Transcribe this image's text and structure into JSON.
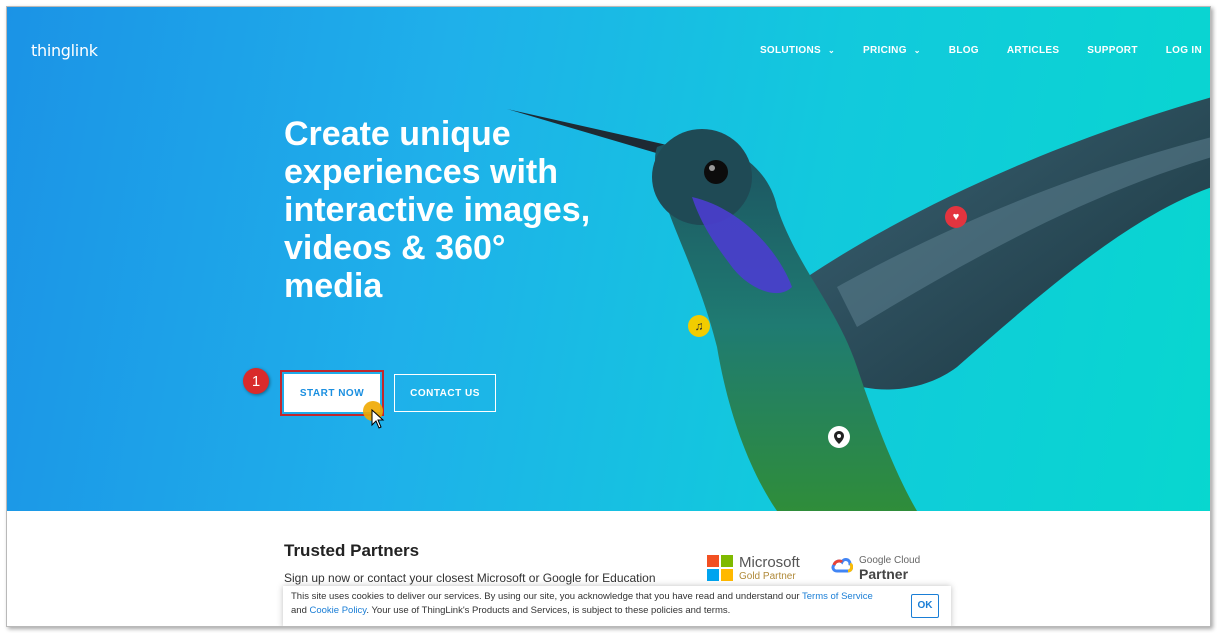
{
  "header": {
    "logo": "thinglink",
    "nav": [
      {
        "label": "SOLUTIONS",
        "has_dropdown": true
      },
      {
        "label": "PRICING",
        "has_dropdown": true
      },
      {
        "label": "BLOG",
        "has_dropdown": false
      },
      {
        "label": "ARTICLES",
        "has_dropdown": false
      },
      {
        "label": "SUPPORT",
        "has_dropdown": false
      },
      {
        "label": "LOG IN",
        "has_dropdown": false
      }
    ]
  },
  "hero": {
    "headline_lines": [
      "Create unique",
      "experiences with",
      "interactive images,",
      "videos & 360°",
      "media"
    ],
    "start_button": "START NOW",
    "contact_button": "CONTACT US",
    "step_badge": "1"
  },
  "partners": {
    "title": "Trusted Partners",
    "text": "Sign up now or contact your closest Microsoft or Google for Education",
    "microsoft": {
      "name": "Microsoft",
      "tier": "Gold Partner"
    },
    "google": {
      "name": "Google Cloud",
      "tier": "Partner"
    }
  },
  "cookie": {
    "text_before_terms": "This site uses cookies to deliver our services. By using our site, you acknowledge that you have read and understand our ",
    "terms_link": "Terms of Service",
    "and": " and ",
    "cookie_link": "Cookie Policy",
    "text_after": ". Your use of ThingLink's Products and Services, is subject to these policies and terms.",
    "ok_label": "OK"
  },
  "colors": {
    "hero_start": "#1b93e6",
    "hero_end": "#08d7cf",
    "highlight_red": "#c1272d",
    "badge_red": "#d92b2b",
    "link_blue": "#1a7ed6"
  },
  "icons": {
    "music_pin": "music-note-icon",
    "heart_pin": "heart-icon",
    "location_pin": "location-pin-icon"
  }
}
